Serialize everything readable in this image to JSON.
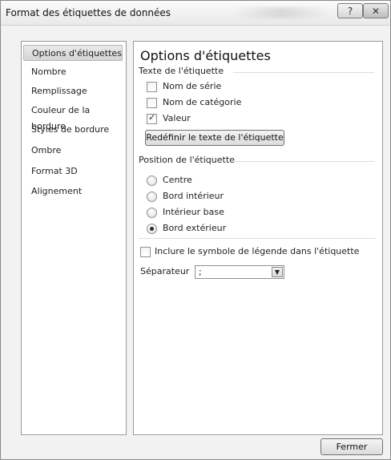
{
  "window": {
    "title": "Format des étiquettes de données",
    "help_label": "?",
    "close_label": "✕"
  },
  "sidebar": {
    "items": [
      {
        "label": "Options d'étiquettes",
        "active": true
      },
      {
        "label": "Nombre"
      },
      {
        "label": "Remplissage"
      },
      {
        "label": "Couleur de la bordure"
      },
      {
        "label": "Styles de bordure"
      },
      {
        "label": "Ombre"
      },
      {
        "label": "Format 3D"
      },
      {
        "label": "Alignement"
      }
    ]
  },
  "panel": {
    "title": "Options d'étiquettes",
    "label_text_section": "Texte de l'étiquette",
    "checkboxes": [
      {
        "label": "Nom de série",
        "checked": false
      },
      {
        "label": "Nom de catégorie",
        "checked": false
      },
      {
        "label": "Valeur",
        "checked": true
      }
    ],
    "reset_button": "Redéfinir le texte de l'étiquette",
    "position_section": "Position de l'étiquette",
    "radios": [
      {
        "label": "Centre",
        "selected": false
      },
      {
        "label": "Bord intérieur",
        "selected": false
      },
      {
        "label": "Intérieur base",
        "selected": false
      },
      {
        "label": "Bord extérieur",
        "selected": true
      }
    ],
    "legend_checkbox": {
      "label": "Inclure le symbole de légende dans l'étiquette",
      "checked": false
    },
    "separator_label": "Séparateur",
    "separator_value": ";"
  },
  "footer": {
    "close_button": "Fermer"
  }
}
